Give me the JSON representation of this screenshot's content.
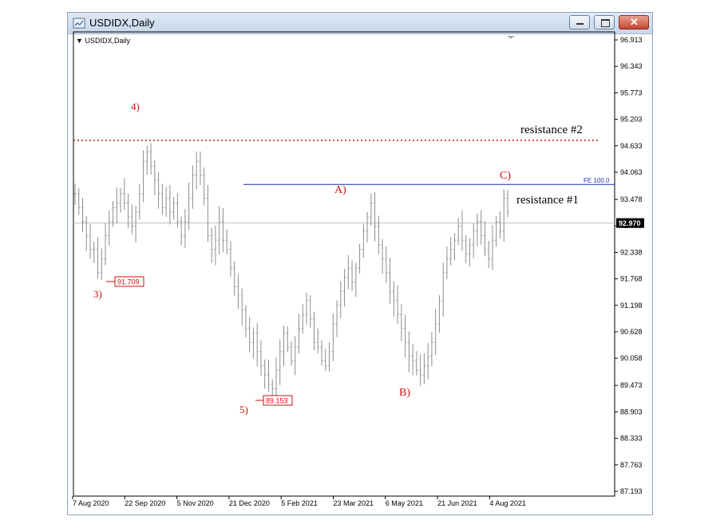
{
  "window": {
    "title": "USDIDX,Daily",
    "controls": [
      "minimize",
      "maximize",
      "close"
    ],
    "icons": {
      "app": "chart-window-icon",
      "dropdown": "triangle-down-icon"
    }
  },
  "chart_data": {
    "type": "ohlc",
    "symbol_label": "USDIDX,Daily",
    "current_price_label": "92.970",
    "current_price": 92.97,
    "y_ticks": [
      "96.913",
      "96.343",
      "95.773",
      "95.203",
      "94.633",
      "94.063",
      "93.478",
      "92.908",
      "92.338",
      "91.768",
      "91.198",
      "90.628",
      "90.058",
      "89.473",
      "88.903",
      "88.333",
      "87.763",
      "87.193"
    ],
    "ylim": [
      87.193,
      96.913
    ],
    "x_ticks": [
      "7 Aug 2020",
      "22 Sep 2020",
      "5 Nov 2020",
      "21 Dec 2020",
      "5 Feb 2021",
      "23 Mar 2021",
      "6 May 2021",
      "21 Jun 2021",
      "4 Aug 2021"
    ],
    "close_path": [
      93.6,
      93.3,
      93.0,
      92.7,
      92.4,
      92.4,
      91.9,
      92.2,
      92.7,
      93.0,
      93.3,
      93.4,
      93.6,
      93.4,
      93.1,
      92.9,
      93.2,
      93.6,
      94.3,
      94.5,
      94.2,
      93.9,
      93.6,
      93.3,
      93.5,
      93.2,
      93.4,
      93.0,
      92.7,
      93.0,
      93.5,
      94.0,
      94.3,
      94.0,
      93.5,
      92.7,
      92.4,
      92.6,
      93.0,
      92.6,
      92.4,
      92.0,
      91.6,
      91.4,
      91.1,
      90.7,
      90.4,
      90.6,
      90.2,
      89.9,
      89.7,
      89.5,
      89.4,
      89.8,
      90.2,
      90.6,
      90.3,
      90.0,
      90.3,
      90.7,
      91.0,
      91.3,
      90.9,
      90.4,
      90.3,
      90.0,
      89.9,
      90.2,
      90.8,
      91.2,
      91.5,
      91.8,
      92.0,
      91.7,
      92.0,
      92.4,
      92.8,
      93.1,
      93.4,
      92.9,
      92.5,
      92.2,
      91.9,
      91.5,
      91.3,
      91.0,
      90.7,
      90.4,
      90.1,
      90.0,
      89.8,
      89.7,
      89.9,
      90.1,
      90.4,
      90.8,
      91.3,
      91.9,
      92.2,
      92.4,
      92.6,
      92.9,
      92.6,
      92.3,
      92.5,
      92.8,
      93.0,
      92.7,
      92.4,
      92.2,
      92.6,
      93.0,
      92.8,
      93.5,
      93.2
    ],
    "annotations": [
      {
        "text": "4)",
        "color": "#cc1111"
      },
      {
        "text": "3)",
        "color": "#cc1111"
      },
      {
        "text": "5)",
        "color": "#cc1111"
      },
      {
        "text": "A)",
        "color": "#cc1111"
      },
      {
        "text": "B)",
        "color": "#cc1111"
      },
      {
        "text": "C)",
        "color": "#cc1111"
      },
      {
        "text": "resistance #2",
        "color": "#000000"
      },
      {
        "text": "resistance #1",
        "color": "#000000"
      },
      {
        "text": "FE 100.0",
        "color": "#1f2fae"
      }
    ],
    "price_boxes": [
      {
        "text": "91.709",
        "value": 91.709
      },
      {
        "text": "89.153",
        "value": 89.153
      }
    ],
    "lines": [
      {
        "name": "resistance-2",
        "value": 94.75,
        "style": "dotted",
        "color": "#cc1111"
      },
      {
        "name": "fe-100",
        "value": 93.8,
        "style": "solid",
        "color": "#1f2fae"
      },
      {
        "name": "current-price",
        "value": 92.97,
        "style": "solid",
        "color": "#c0c0c0"
      }
    ]
  }
}
